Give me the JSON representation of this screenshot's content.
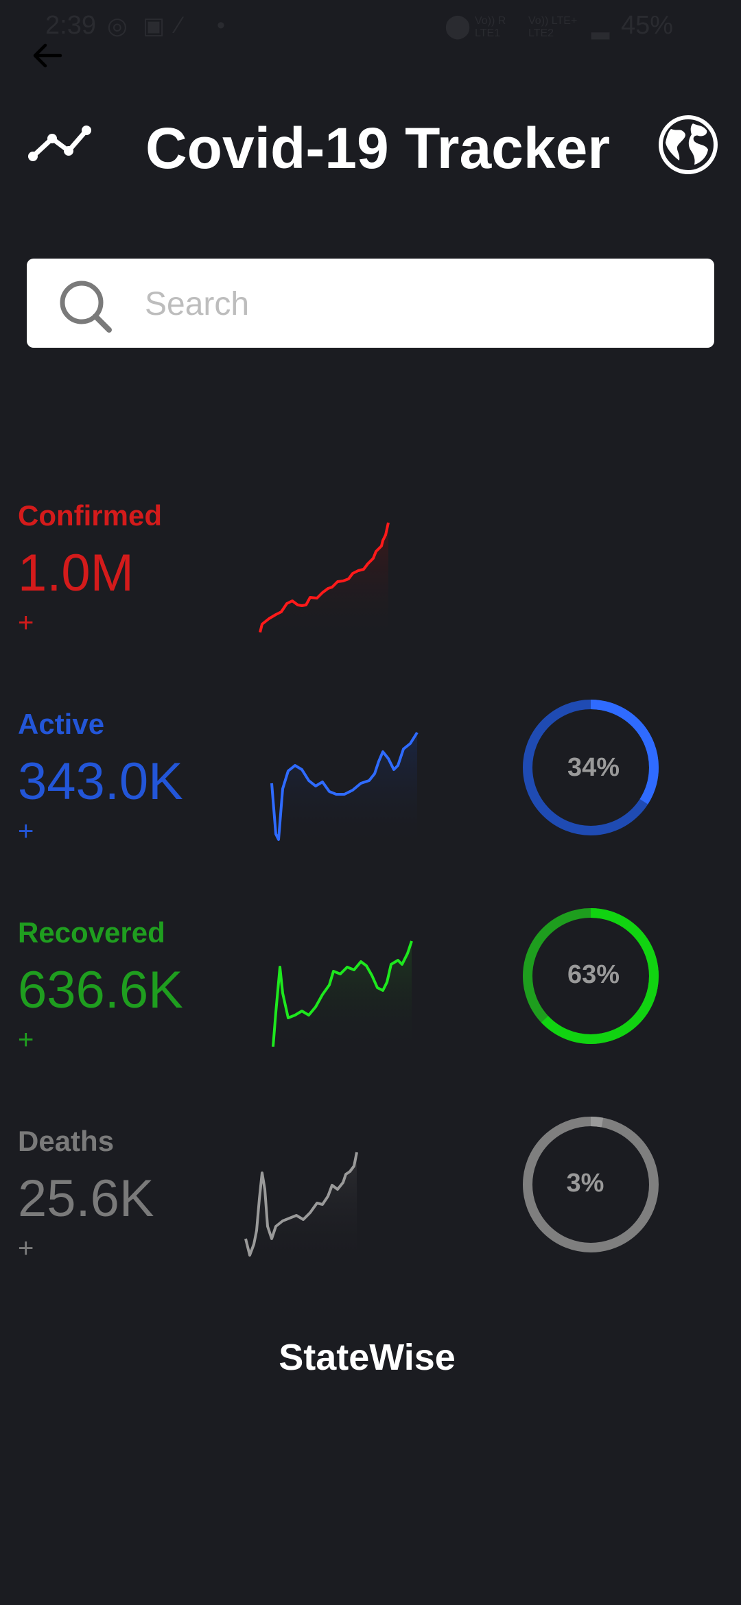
{
  "status_bar": {
    "time": "2:39",
    "battery": "45%",
    "network_line1a": "Vo)) R",
    "network_line1b": "LTE1",
    "network_line2a": "Vo)) LTE+",
    "network_line2b": "LTE2"
  },
  "header": {
    "title": "Covid-19 Tracker"
  },
  "search": {
    "placeholder": "Search",
    "value": ""
  },
  "stats": [
    {
      "label": "Confirmed",
      "value": "1.0M",
      "delta": "+",
      "color": "#d41b1b"
    },
    {
      "label": "Active",
      "value": "343.0K",
      "delta": "+",
      "color": "#2356d8",
      "percent": "34%",
      "percent_value": 34
    },
    {
      "label": "Recovered",
      "value": "636.6K",
      "delta": "+",
      "color": "#1f9e1f",
      "percent": "63%",
      "percent_value": 63
    },
    {
      "label": "Deaths",
      "value": "25.6K",
      "delta": "+",
      "color": "#7a7a7a",
      "percent": "3%",
      "percent_value": 3
    }
  ],
  "footer": {
    "statewise_label": "StateWise"
  },
  "colors": {
    "background": "#1b1c21",
    "confirmed_line": "#ff1a1a",
    "active_line": "#2f6bff",
    "recovered_line": "#1ee81e",
    "deaths_line": "#9a9a9a"
  }
}
